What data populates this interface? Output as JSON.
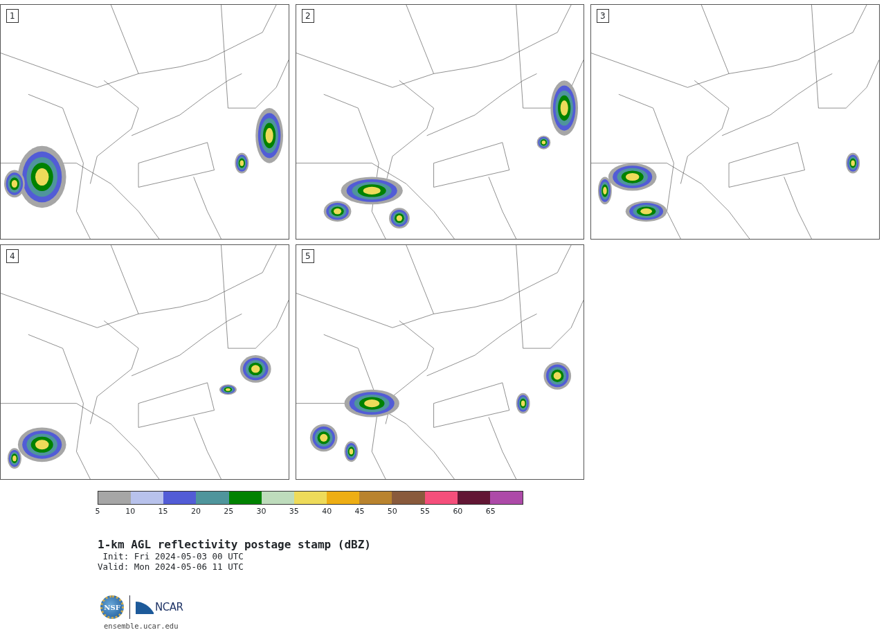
{
  "panels": [
    {
      "label": "1"
    },
    {
      "label": "2"
    },
    {
      "label": "3"
    },
    {
      "label": "4"
    },
    {
      "label": "5"
    }
  ],
  "colorbar": {
    "bins": [
      {
        "color": "#a6a6a6",
        "label": "5"
      },
      {
        "color": "#b8c2ec",
        "label": "10"
      },
      {
        "color": "#525cd6",
        "label": "15"
      },
      {
        "color": "#4f959c",
        "label": "20"
      },
      {
        "color": "#008200",
        "label": "25"
      },
      {
        "color": "#bedcbc",
        "label": "30"
      },
      {
        "color": "#eedb5a",
        "label": "35"
      },
      {
        "color": "#eeae14",
        "label": "40"
      },
      {
        "color": "#b9832e",
        "label": "45"
      },
      {
        "color": "#895a3c",
        "label": "50"
      },
      {
        "color": "#f54f7b",
        "label": "55"
      },
      {
        "color": "#621634",
        "label": "60"
      },
      {
        "color": "#ad4aa8",
        "label": "65"
      }
    ]
  },
  "title": "1-km AGL reflectivity postage stamp (dBZ)",
  "init": " Init: Fri 2024-05-03 00 UTC",
  "valid": "Valid: Mon 2024-05-06 11 UTC",
  "logo": {
    "nsf": "NSF",
    "ncar": "NCAR"
  },
  "url": "ensemble.ucar.edu"
}
